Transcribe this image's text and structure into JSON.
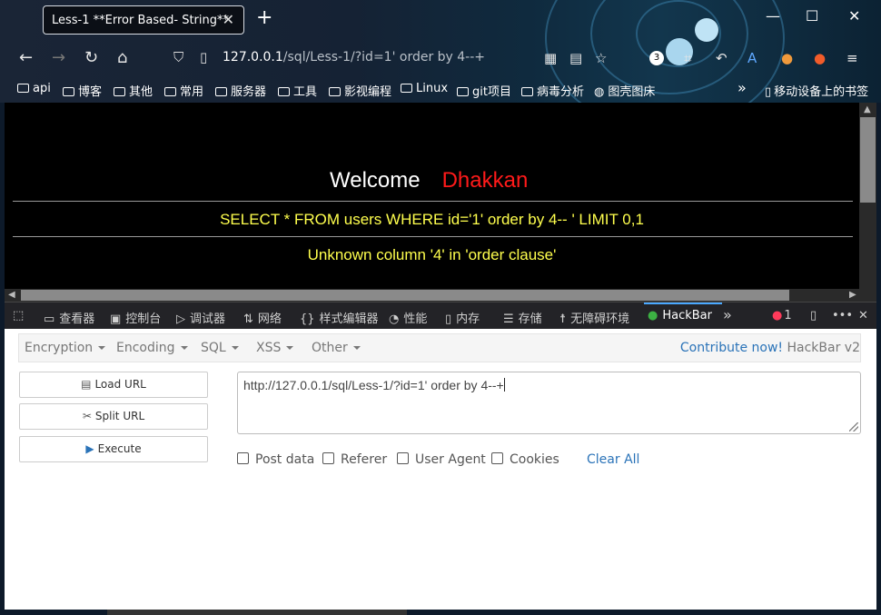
{
  "tab": {
    "title": "Less-1 **Error Based- String**",
    "close": "✕"
  },
  "newtab": "+",
  "window": {
    "minimize": "—",
    "maximize": "☐",
    "close": "✕"
  },
  "url": {
    "host": "127.0.0.1",
    "path": "/sql/Less-1/?id=1' order by 4--+"
  },
  "toolbar": {
    "badge": "3"
  },
  "bookmarks": [
    "api",
    "博客",
    "其他",
    "常用",
    "服务器",
    "工具",
    "影视编程",
    "Linux",
    "git项目",
    "病毒分析",
    "图壳图床"
  ],
  "bookmarks_more": "»",
  "mobile_bookmarks": "移动设备上的书签",
  "page": {
    "welcome": "Welcome",
    "name": "Dhakkan",
    "query": "SELECT * FROM users WHERE id='1' order by 4-- ' LIMIT 0,1",
    "error": "Unknown column '4' in 'order clause'"
  },
  "devtools": {
    "tabs": [
      "查看器",
      "控制台",
      "调试器",
      "网络",
      "样式编辑器",
      "性能",
      "内存",
      "存储",
      "无障碍环境",
      "HackBar"
    ],
    "errors": "1"
  },
  "hackbar": {
    "menus": [
      "Encryption",
      "Encoding",
      "SQL",
      "XSS",
      "Other"
    ],
    "contribute": "Contribute now!",
    "version": "HackBar v2",
    "load_url": "Load URL",
    "split_url": "Split URL",
    "execute": "Execute",
    "url_value": "http://127.0.0.1/sql/Less-1/?id=1' order by 4--+",
    "options": [
      "Post data",
      "Referer",
      "User Agent",
      "Cookies"
    ],
    "clear_all": "Clear All"
  }
}
